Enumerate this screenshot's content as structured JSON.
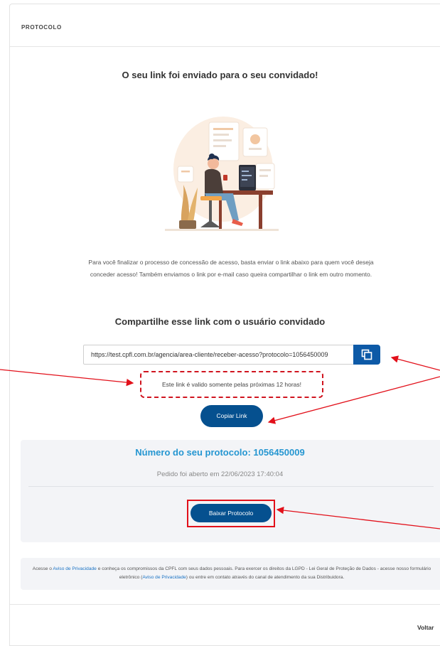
{
  "card": {
    "title": "PROTOCOLO"
  },
  "main": {
    "headline": "O seu link foi enviado para o seu convidado!",
    "description": "Para você finalizar o processo de concessão de acesso, basta enviar o link abaixo para quem você deseja conceder acesso! Também enviamos o link por e-mail caso queira compartilhar o link em outro momento.",
    "share_title": "Compartilhe esse link com o usuário convidado",
    "link_value": "https://test.cpfl.com.br/agencia/area-cliente/receber-acesso?protocolo=1056450009",
    "validity_notice": "Este link é valido somente pelas próximas 12 horas!",
    "copy_button": "Copiar Link"
  },
  "protocol": {
    "number_label": "Número do seu protocolo: 1056450009",
    "opened_label": "Pedido foi aberto em 22/06/2023 17:40:04",
    "download_button": "Baixar Protocolo"
  },
  "privacy": {
    "part1": "Acesse o ",
    "link1": "Aviso de Privacidade",
    "part2": " e conheça os compromissos da CPFL com seus dados pessoais. Para exercer os direitos da LGPD - Lei Geral de Proteção de Dados - acesse nosso formulário eletrônico (",
    "link2": "Aviso de Privacidade",
    "part3": ") ou entre em contato através do canal de atendimento da sua Distribuidora."
  },
  "footer": {
    "back": "Voltar"
  },
  "colors": {
    "primary": "#05508f",
    "accent": "#2596d1",
    "annotation": "#e2101a",
    "panel": "#f3f4f7"
  },
  "icons": {
    "copy": "copy-icon",
    "illustration": "woman-at-desk-illustration"
  }
}
